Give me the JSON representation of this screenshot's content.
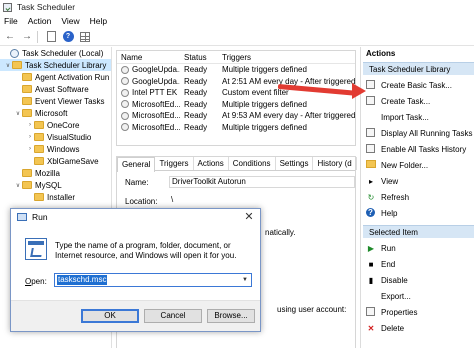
{
  "window": {
    "title": "Task Scheduler"
  },
  "menu": [
    "File",
    "Action",
    "View",
    "Help"
  ],
  "tree": {
    "items": [
      {
        "label": "Task Scheduler (Local)",
        "indent": 0,
        "expander": "",
        "icon": "clock"
      },
      {
        "label": "Task Scheduler Library",
        "indent": 1,
        "expander": "v",
        "icon": "folder",
        "selected": true
      },
      {
        "label": "Agent Activation Run",
        "indent": 2,
        "expander": "",
        "icon": "folder"
      },
      {
        "label": "Avast Software",
        "indent": 2,
        "expander": "",
        "icon": "folder"
      },
      {
        "label": "Event Viewer Tasks",
        "indent": 2,
        "expander": "",
        "icon": "folder"
      },
      {
        "label": "Microsoft",
        "indent": 2,
        "expander": "v",
        "icon": "folder"
      },
      {
        "label": "OneCore",
        "indent": 3,
        "expander": ">",
        "icon": "folder"
      },
      {
        "label": "VisualStudio",
        "indent": 3,
        "expander": ">",
        "icon": "folder"
      },
      {
        "label": "Windows",
        "indent": 3,
        "expander": ">",
        "icon": "folder"
      },
      {
        "label": "XblGameSave",
        "indent": 3,
        "expander": "",
        "icon": "folder"
      },
      {
        "label": "Mozilla",
        "indent": 2,
        "expander": "",
        "icon": "folder"
      },
      {
        "label": "MySQL",
        "indent": 2,
        "expander": "v",
        "icon": "folder"
      },
      {
        "label": "Installer",
        "indent": 3,
        "expander": "",
        "icon": "folder"
      }
    ]
  },
  "tasks": {
    "columns": [
      "Name",
      "Status",
      "Triggers"
    ],
    "rows": [
      {
        "name": "GoogleUpda...",
        "status": "Ready",
        "triggers": "Multiple triggers defined"
      },
      {
        "name": "GoogleUpda...",
        "status": "Ready",
        "triggers": "At 2:51 AM every day - After triggered"
      },
      {
        "name": "Intel PTT EK ...",
        "status": "Ready",
        "triggers": "Custom event filter"
      },
      {
        "name": "MicrosoftEd...",
        "status": "Ready",
        "triggers": "Multiple triggers defined"
      },
      {
        "name": "MicrosoftEd...",
        "status": "Ready",
        "triggers": "At 9:53 AM every day - After triggered"
      },
      {
        "name": "MicrosoftEd...",
        "status": "Ready",
        "triggers": "Multiple triggers defined"
      }
    ]
  },
  "detail": {
    "tabs": [
      "General",
      "Triggers",
      "Actions",
      "Conditions",
      "Settings",
      "History (d"
    ],
    "name_label": "Name:",
    "name_value": "DriverToolkit Autorun",
    "location_label": "Location:",
    "location_value": "\\",
    "partial_text_1": "natically.",
    "partial_text_2": "using user account:"
  },
  "actions_pane": {
    "header": "Actions",
    "section1": "Task Scheduler Library",
    "items1": [
      {
        "label": "Create Basic Task...",
        "icon": "create-basic-task-icon"
      },
      {
        "label": "Create Task...",
        "icon": "create-task-icon"
      },
      {
        "label": "Import Task...",
        "icon": "import-icon"
      },
      {
        "label": "Display All Running Tasks",
        "icon": "running-tasks-icon"
      },
      {
        "label": "Enable All Tasks History",
        "icon": "history-icon"
      },
      {
        "label": "New Folder...",
        "icon": "new-folder-icon"
      },
      {
        "label": "View",
        "icon": "view-icon"
      },
      {
        "label": "Refresh",
        "icon": "refresh-icon"
      },
      {
        "label": "Help",
        "icon": "help-icon"
      }
    ],
    "section2": "Selected Item",
    "items2": [
      {
        "label": "Run",
        "icon": "run-icon"
      },
      {
        "label": "End",
        "icon": "end-icon"
      },
      {
        "label": "Disable",
        "icon": "disable-icon"
      },
      {
        "label": "Export...",
        "icon": "export-icon"
      },
      {
        "label": "Properties",
        "icon": "properties-icon"
      },
      {
        "label": "Delete",
        "icon": "delete-icon"
      }
    ]
  },
  "run_dialog": {
    "title": "Run",
    "description": "Type the name of a program, folder, document, or Internet resource, and Windows will open it for you.",
    "open_label_prefix": "",
    "open_label_underlined": "O",
    "open_label_rest": "pen:",
    "input_value": "taskschd.msc",
    "ok_label": "OK",
    "cancel_label": "Cancel",
    "browse_label": "Browse..."
  },
  "colors": {
    "annotation_arrow": "#e23b32",
    "selection": "#cce8ff",
    "section_header": "#d6e6f5"
  }
}
